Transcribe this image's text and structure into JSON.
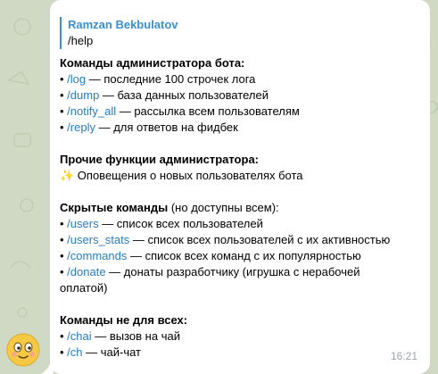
{
  "reply": {
    "author": "Ramzan Bekbulatov",
    "text": "/help"
  },
  "sections": [
    {
      "title": "Команды администратора бота:",
      "items": [
        {
          "cmd": "/log",
          "desc": " — последние 100 строчек лога"
        },
        {
          "cmd": "/dump",
          "desc": " — база данных пользователей"
        },
        {
          "cmd": "/notify_all",
          "desc": " — рассылка всем пользователям"
        },
        {
          "cmd": "/reply",
          "desc": " — для ответов на фидбек"
        }
      ]
    },
    {
      "title": "Прочие функции администратора:",
      "note_icon": "✨",
      "note": " Оповещения о новых пользователях бота"
    },
    {
      "title": "Скрытые команды",
      "title_suffix": " (но доступны всем):",
      "items": [
        {
          "cmd": "/users",
          "desc": " — список всех пользователей"
        },
        {
          "cmd": "/users_stats",
          "desc": " — список всех пользователей с их активностью"
        },
        {
          "cmd": "/commands",
          "desc": " — список всех команд с их популярностью"
        },
        {
          "cmd": "/donate",
          "desc": " — донаты разработчику (игрушка с нерабочей"
        }
      ],
      "continuation": "оплатой)"
    },
    {
      "title": "Команды не для всех:",
      "items": [
        {
          "cmd": "/chai",
          "desc": " — вызов на чай"
        },
        {
          "cmd": "/ch",
          "desc": " — чай-чат"
        }
      ]
    }
  ],
  "bullet": "• ",
  "time": "16:21",
  "avatar_icon": "smiling-face-emoji-avatar"
}
